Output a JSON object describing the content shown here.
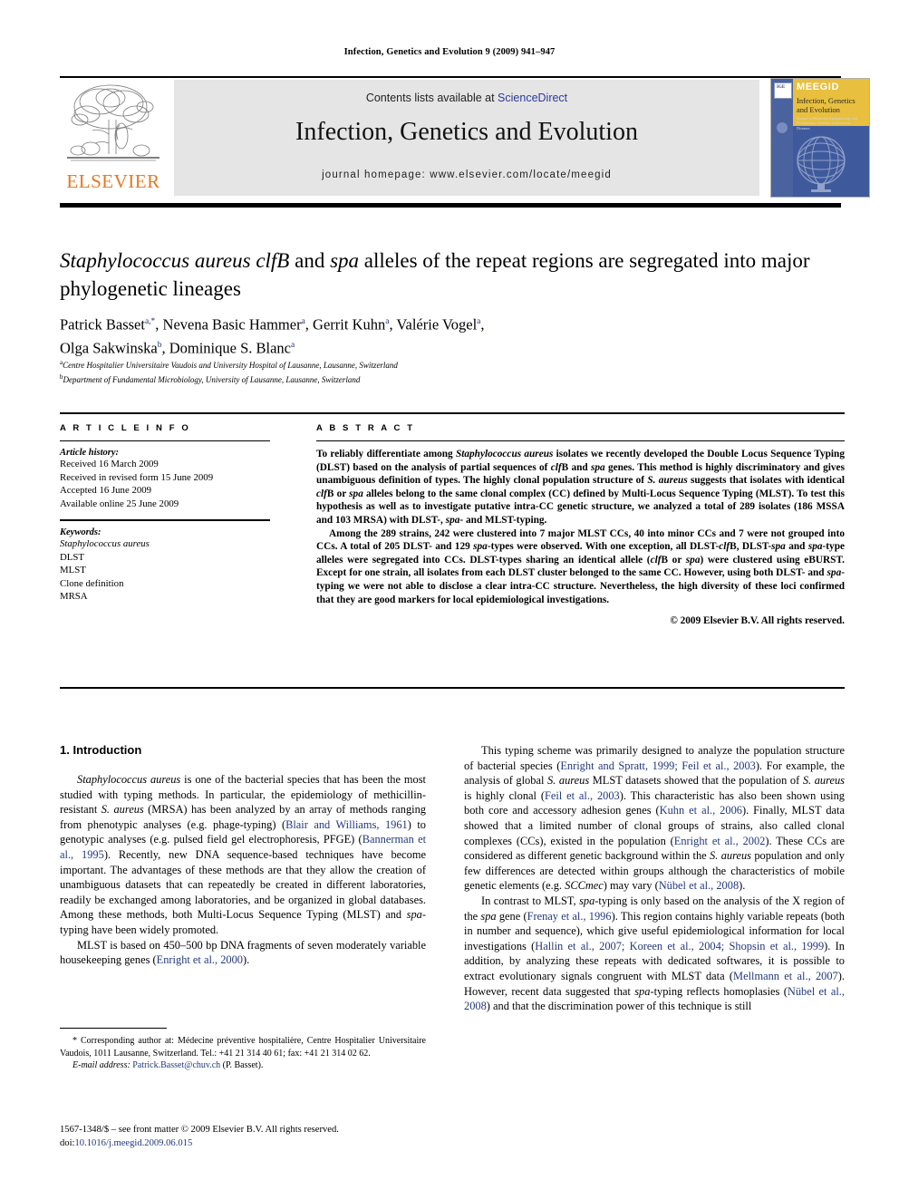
{
  "running_head": "Infection, Genetics and Evolution 9 (2009) 941–947",
  "masthead": {
    "publisher_logo_label": "ELSEVIER",
    "contents_prefix": "Contents lists available at ",
    "contents_link": "ScienceDirect",
    "journal_title": "Infection, Genetics and Evolution",
    "homepage": "journal homepage: www.elsevier.com/locate/meegid",
    "cover": {
      "masthead_code": "MEEGID",
      "name": "Infection, Genetics and Evolution",
      "subtitle": "Journal of Molecular Epidemiology and Evolutionary Genetics in Infectious Diseases",
      "badge": "IGE"
    }
  },
  "article": {
    "title_part1": "Staphylococcus aureus clfB",
    "title_part2": " and ",
    "title_part3": "spa",
    "title_part4": " alleles of the repeat regions are segregated into major phylogenetic lineages",
    "authors_line1": "Patrick Basset",
    "authors": [
      {
        "name": "Patrick Basset",
        "sup": "a,*"
      },
      {
        "name": "Nevena Basic Hammer",
        "sup": "a"
      },
      {
        "name": "Gerrit Kuhn",
        "sup": "a"
      },
      {
        "name": "Valérie Vogel",
        "sup": "a"
      },
      {
        "name": "Olga Sakwinska",
        "sup": "b"
      },
      {
        "name": "Dominique S. Blanc",
        "sup": "a"
      }
    ],
    "affiliations": [
      {
        "mark": "a",
        "text": "Centre Hospitalier Universitaire Vaudois and University Hospital of Lausanne, Lausanne, Switzerland"
      },
      {
        "mark": "b",
        "text": "Department of Fundamental Microbiology, University of Lausanne, Lausanne, Switzerland"
      }
    ]
  },
  "article_info": {
    "heading": "A R T I C L E  I N F O",
    "history_label": "Article history:",
    "history": [
      "Received 16 March 2009",
      "Received in revised form 15 June 2009",
      "Accepted 16 June 2009",
      "Available online 25 June 2009"
    ],
    "keywords_label": "Keywords:",
    "keywords": [
      "Staphylococcus aureus",
      "DLST",
      "MLST",
      "Clone definition",
      "MRSA"
    ]
  },
  "abstract": {
    "heading": "A B S T R A C T",
    "para1_a": "To reliably differentiate among ",
    "para1_it1": "Staphylococcus aureus",
    "para1_b": " isolates we recently developed the Double Locus Sequence Typing (DLST) based on the analysis of partial sequences of ",
    "para1_it2": "clf",
    "para1_c": "B and ",
    "para1_it3": "spa",
    "para1_d": " genes. This method is highly discriminatory and gives unambiguous definition of types. The highly clonal population structure of ",
    "para1_it4": "S. aureus",
    "para1_e": " suggests that isolates with identical ",
    "para1_it5": "clf",
    "para1_f": "B or ",
    "para1_it6": "spa",
    "para1_g": " alleles belong to the same clonal complex (CC) defined by Multi-Locus Sequence Typing (MLST). To test this hypothesis as well as to investigate putative intra-CC genetic structure, we analyzed a total of 289 isolates (186 MSSA and 103 MRSA) with DLST-, ",
    "para1_it7": "spa",
    "para1_h": "- and MLST-typing.",
    "para2_a": "Among the 289 strains, 242 were clustered into 7 major MLST CCs, 40 into minor CCs and 7 were not grouped into CCs. A total of 205 DLST- and 129 ",
    "para2_it1": "spa",
    "para2_b": "-types were observed. With one exception, all DLST-",
    "para2_it2": "clf",
    "para2_c": "B, DLST-",
    "para2_it3": "spa",
    "para2_d": " and ",
    "para2_it4": "spa",
    "para2_e": "-type alleles were segregated into CCs. DLST-types sharing an identical allele (",
    "para2_it5": "clf",
    "para2_f": "B or ",
    "para2_it6": "spa",
    "para2_g": ") were clustered using eBURST. Except for one strain, all isolates from each DLST cluster belonged to the same CC. However, using both DLST- and ",
    "para2_it7": "spa",
    "para2_h": "-typing we were not able to disclose a clear intra-CC structure. Nevertheless, the high diversity of these loci confirmed that they are good markers for local epidemiological investigations.",
    "copyright": "© 2009 Elsevier B.V. All rights reserved."
  },
  "introduction": {
    "heading": "1. Introduction",
    "left": {
      "p1_it1": "Staphylococcus aureus",
      "p1_a": " is one of the bacterial species that has been the most studied with typing methods. In particular, the epidemiology of methicillin-resistant ",
      "p1_it2": "S. aureus",
      "p1_b": " (MRSA) has been analyzed by an array of methods ranging from phenotypic analyses (e.g. phage-typing) (",
      "p1_ref1": "Blair and Williams, 1961",
      "p1_c": ") to genotypic analyses (e.g. pulsed field gel electrophoresis, PFGE) (",
      "p1_ref2": "Bannerman et al., 1995",
      "p1_d": "). Recently, new DNA sequence-based techniques have become important. The advantages of these methods are that they allow the creation of unambiguous datasets that can repeatedly be created in different laboratories, readily be exchanged among laboratories, and be organized in global databases. Among these methods, both Multi-Locus Sequence Typing (MLST) and ",
      "p1_it3": "spa",
      "p1_e": "-typing have been widely promoted.",
      "p2_a": "MLST is based on 450–500 bp DNA fragments of seven moderately variable housekeeping genes (",
      "p2_ref1": "Enright et al., 2000",
      "p2_b": ")."
    },
    "right": {
      "p1_a": "This typing scheme was primarily designed to analyze the population structure of bacterial species (",
      "p1_ref1": "Enright and Spratt, 1999; Feil et al., 2003",
      "p1_b": "). For example, the analysis of global ",
      "p1_it1": "S. aureus",
      "p1_c": " MLST datasets showed that the population of ",
      "p1_it2": "S. aureus",
      "p1_d": " is highly clonal (",
      "p1_ref2": "Feil et al., 2003",
      "p1_e": "). This characteristic has also been shown using both core and accessory adhesion genes (",
      "p1_ref3": "Kuhn et al., 2006",
      "p1_f": "). Finally, MLST data showed that a limited number of clonal groups of strains, also called clonal complexes (CCs), existed in the population (",
      "p1_ref4": "Enright et al., 2002",
      "p1_g": "). These CCs are considered as different genetic background within the ",
      "p1_it3": "S. aureus",
      "p1_h": " population and only few differences are detected within groups although the characteristics of mobile genetic elements (e.g. ",
      "p1_it4": "SCCmec",
      "p1_i": ") may vary (",
      "p1_ref5": "Nübel et al., 2008",
      "p1_j": ").",
      "p2_a": "In contrast to MLST, ",
      "p2_it1": "spa",
      "p2_b": "-typing is only based on the analysis of the X region of the ",
      "p2_it2": "spa",
      "p2_c": " gene (",
      "p2_ref1": "Frenay et al., 1996",
      "p2_d": "). This region contains highly variable repeats (both in number and sequence), which give useful epidemiological information for local investigations (",
      "p2_ref2": "Hallin et al., 2007; Koreen et al., 2004; Shopsin et al., 1999",
      "p2_e": "). In addition, by analyzing these repeats with dedicated softwares, it is possible to extract evolutionary signals congruent with MLST data (",
      "p2_ref3": "Mellmann et al., 2007",
      "p2_f": "). However, recent data suggested that ",
      "p2_it3": "spa",
      "p2_g": "-typing reflects homoplasies (",
      "p2_ref4": "Nübel et al., 2008",
      "p2_h": ") and that the discrimination power of this technique is still"
    }
  },
  "footnote": {
    "corresponding": "* Corresponding author at: Médecine préventive hospitalière, Centre Hospitalier Universitaire Vaudois, 1011 Lausanne, Switzerland. Tel.: +41 21 314 40 61; fax: +41 21 314 02 62.",
    "email_label": "E-mail address:",
    "email": "Patrick.Basset@chuv.ch",
    "email_author": " (P. Basset)."
  },
  "imprint": {
    "issn_line": "1567-1348/$ – see front matter © 2009 Elsevier B.V. All rights reserved.",
    "doi_label": "doi:",
    "doi": "10.1016/j.meegid.2009.06.015"
  },
  "colors": {
    "link_blue": "#23387d",
    "elsevier_orange": "#E87722",
    "banner_gray": "#e5e5e5",
    "cover_blue": "#3f5a9c",
    "cover_yellow": "#e8bf3e"
  }
}
